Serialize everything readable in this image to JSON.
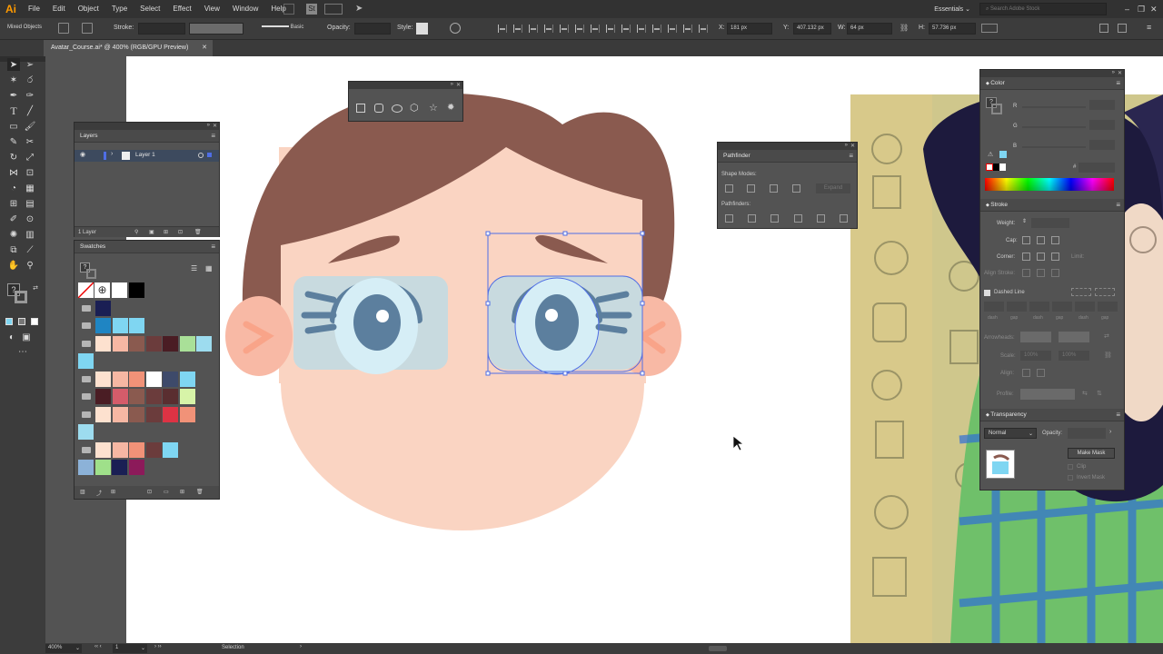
{
  "app": {
    "logo": "Ai"
  },
  "menu": [
    "File",
    "Edit",
    "Object",
    "Type",
    "Select",
    "Effect",
    "View",
    "Window",
    "Help"
  ],
  "workspace": "Essentials",
  "search_placeholder": "Search Adobe Stock",
  "control": {
    "selection": "Mixed Objects",
    "stroke_label": "Stroke:",
    "stroke_profile": "Basic",
    "opacity_label": "Opacity:",
    "style_label": "Style:",
    "x_label": "X:",
    "x_value": "181 px",
    "y_label": "Y:",
    "y_value": "407.132 px",
    "w_label": "W:",
    "w_value": "64 px",
    "h_label": "H:",
    "h_value": "57.736 px"
  },
  "document_tab": "Avatar_Course.ai* @ 400% (RGB/GPU Preview)",
  "layers_panel": {
    "title": "Layers",
    "layer_name": "Layer 1",
    "count": "1 Layer"
  },
  "swatches_panel": {
    "title": "Swatches"
  },
  "shapes_panel": {
    "tools": [
      "rectangle",
      "rounded-rectangle",
      "ellipse",
      "polygon",
      "star",
      "flare"
    ]
  },
  "pathfinder_panel": {
    "title": "Pathfinder",
    "shape_modes": "Shape Modes:",
    "expand": "Expand",
    "pathfinders": "Pathfinders:"
  },
  "color_panel": {
    "title": "Color",
    "r": "R",
    "g": "G",
    "b": "B",
    "hex_prefix": "#"
  },
  "stroke_panel": {
    "title": "Stroke",
    "weight": "Weight:",
    "cap": "Cap:",
    "corner": "Corner:",
    "limit": "Limit:",
    "align": "Align Stroke:",
    "dashed": "Dashed Line",
    "dash_labels": [
      "dash",
      "gap",
      "dash",
      "gap",
      "dash",
      "gap"
    ],
    "arrowheads": "Arrowheads:",
    "scale": "Scale:",
    "scale_value_1": "100%",
    "scale_value_2": "100%",
    "align_label": "Align:",
    "profile": "Profile:"
  },
  "transparency_panel": {
    "title": "Transparency",
    "blend_mode": "Normal",
    "opacity_label": "Opacity:",
    "make_mask": "Make Mask",
    "clip": "Clip",
    "invert_mask": "Invert Mask"
  },
  "status": {
    "zoom": "400%",
    "artboard": "1",
    "tool": "Selection"
  },
  "colors": {
    "hair": "#8a5a4f",
    "skin": "#fad4c2",
    "ear_inner": "#f9a489",
    "glasses": "#c8dadf",
    "eye_white": "#d6eef6",
    "iris": "#5c7f9e",
    "brow": "#8a5a4f",
    "lash": "#5c7f9e",
    "selection": "#4f6ee5"
  },
  "swatch_colors": [
    [
      "#ffffff",
      "#000000"
    ],
    [
      "#1a1f54"
    ],
    [
      "#1f85c3",
      "#7fd6f2",
      "#7fd6f2"
    ],
    [
      "#fde1cf",
      "#f6b7a3",
      "#8a5a4f",
      "#6b3c3c",
      "#4a1d24",
      "#a9e098",
      "#9ddcef"
    ],
    [
      "#7fd6f2"
    ],
    [
      "#fde1cf",
      "#f6b7a3",
      "#f19278",
      "#ffffff",
      "#3e4a6a",
      "#7fd6f2"
    ],
    [
      "#4a1d24",
      "#d45c6a",
      "#8a5a4f",
      "#6b3c3c",
      "#5a2e30",
      "#d7f4a8"
    ],
    [
      "#fde1cf",
      "#f6b7a3",
      "#8a5a4f",
      "#6b3c3c",
      "#dd3344",
      "#f19278"
    ],
    [
      "#9ddcef"
    ],
    [
      "#fde1cf",
      "#f6b7a3",
      "#f19278",
      "#6b3c3c",
      "#7fd6f2"
    ],
    [
      "#8cb2d8",
      "#9fe08a",
      "#1a1f54",
      "#8c1a5a"
    ]
  ]
}
